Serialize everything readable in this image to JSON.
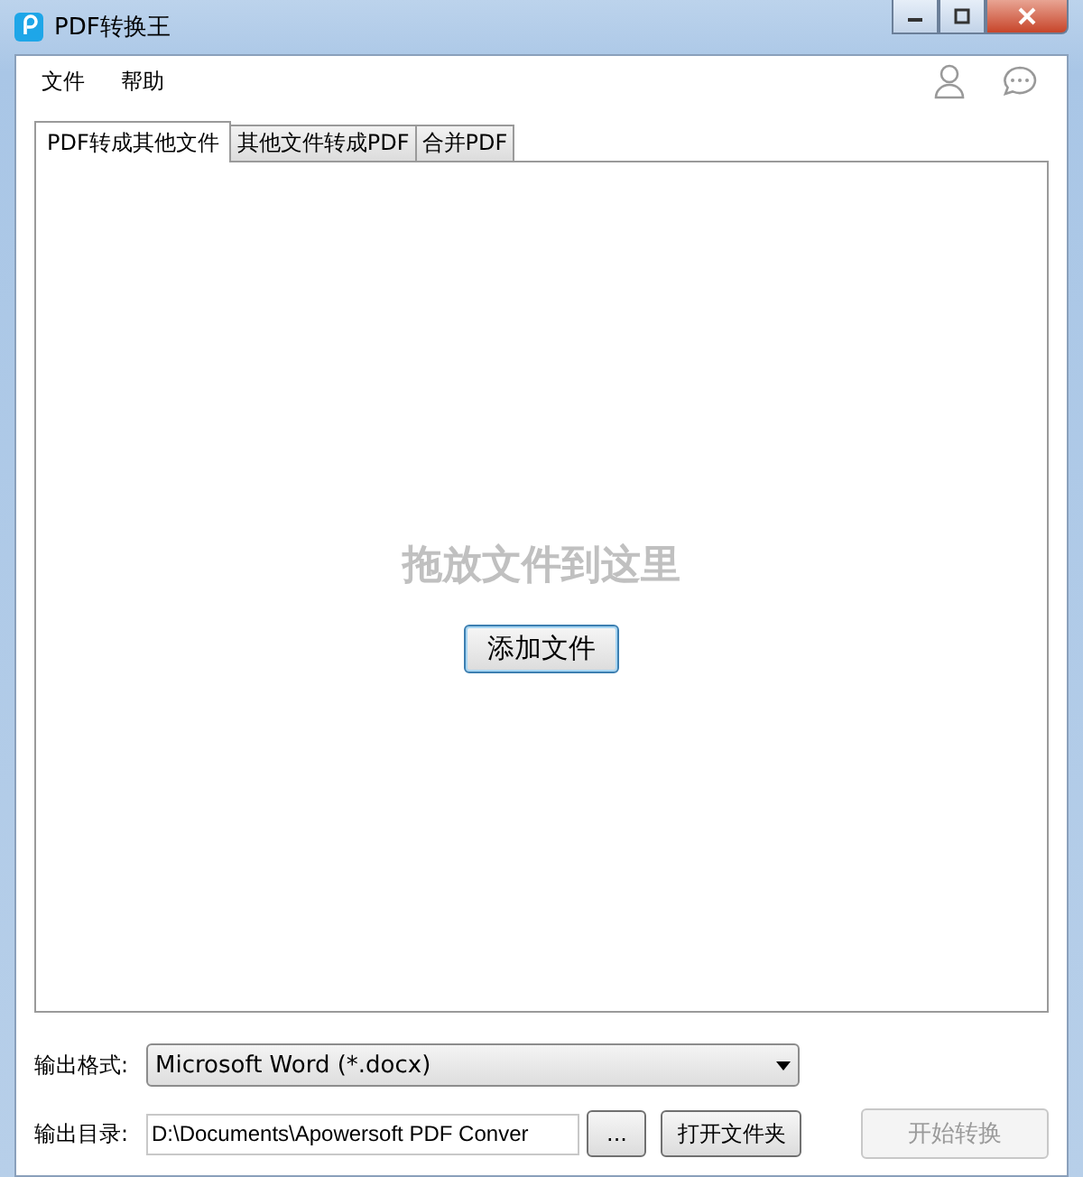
{
  "window": {
    "title": "PDF转换王"
  },
  "menu": [
    "文件",
    "帮助"
  ],
  "tabs": [
    {
      "label": "PDF转成其他文件",
      "selected": true
    },
    {
      "label": "其他文件转成PDF",
      "selected": false
    },
    {
      "label": "合并PDF",
      "selected": false
    }
  ],
  "drop_area": {
    "hint": "拖放文件到这里",
    "button": "添加文件"
  },
  "output_format": {
    "label": "输出格式:",
    "value": "Microsoft Word (*.docx)"
  },
  "output_dir": {
    "label": "输出目录:",
    "value": "D:\\Documents\\Apowersoft PDF Conver",
    "browse": "...",
    "open_folder": "打开文件夹"
  },
  "start_button": {
    "label": "开始转换",
    "disabled": true
  }
}
